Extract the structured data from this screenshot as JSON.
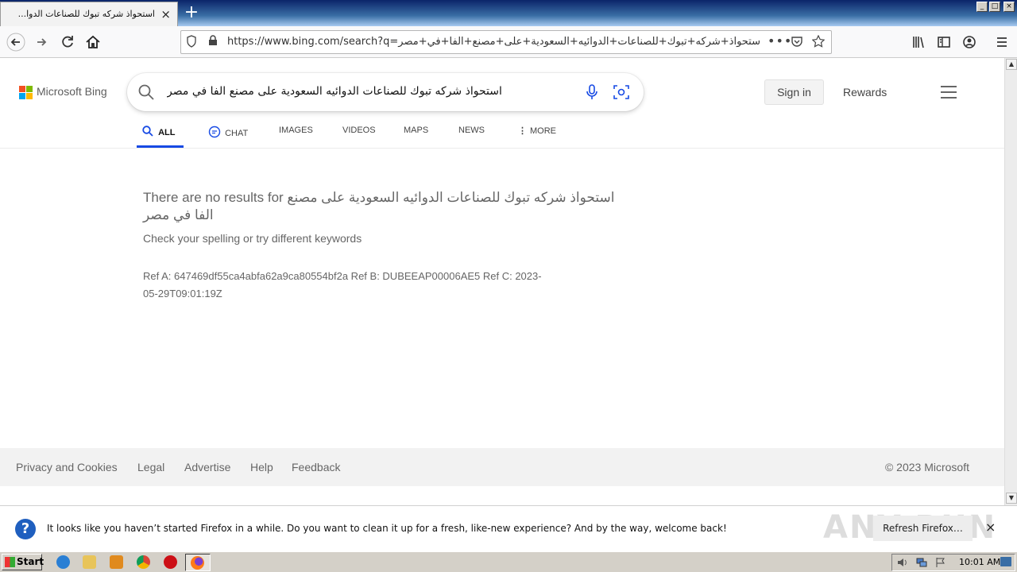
{
  "browser": {
    "tab_title": "استحواذ شركه تبوك للصناعات الدوا...",
    "tab_close_icon": "×",
    "new_tab_icon": "+",
    "url": "https://www.bing.com/search?q=استحواذ+شركه+تبوك+للصناعات+الدوائيه+السعودية+على+مصنع+الفا+في+مصر&qs=n&",
    "window_buttons": [
      "_",
      "□",
      "×"
    ]
  },
  "bing": {
    "logo_text": "Microsoft Bing",
    "search_query": "استحواذ شركه تبوك للصناعات الدوائيه السعودية على مصنع الفا في مصر",
    "signin_label": "Sign in",
    "rewards_label": "Rewards",
    "logo_colors": [
      "#f25022",
      "#7fba00",
      "#00a4ef",
      "#ffb900"
    ],
    "accent_color": "#174ae4"
  },
  "scopes": {
    "all": "ALL",
    "chat": "CHAT",
    "images": "IMAGES",
    "videos": "VIDEOS",
    "maps": "MAPS",
    "news": "NEWS",
    "more": "MORE"
  },
  "results": {
    "no_results": "There are no results for استحواذ شركه تبوك للصناعات الدوائيه السعودية على مصنع الفا في مصر",
    "spelling": "Check your spelling or try different keywords",
    "refs": "Ref A: 647469df55ca4abfa62a9ca80554bf2a Ref B: DUBEEAP00006AE5 Ref C: 2023-05-29T09:01:19Z"
  },
  "footer": {
    "links": [
      "Privacy and Cookies",
      "Legal",
      "Advertise",
      "Help",
      "Feedback"
    ],
    "copyright": "© 2023 Microsoft"
  },
  "notification": {
    "text": "It looks like you haven’t started Firefox in a while. Do you want to clean it up for a fresh, like-new experience? And by the way, welcome back!",
    "button_label": "Refresh Firefox…",
    "close_icon": "×",
    "watermark": "ANY RUN"
  },
  "taskbar": {
    "start_label": "Start",
    "clock": "10:01 AM"
  }
}
